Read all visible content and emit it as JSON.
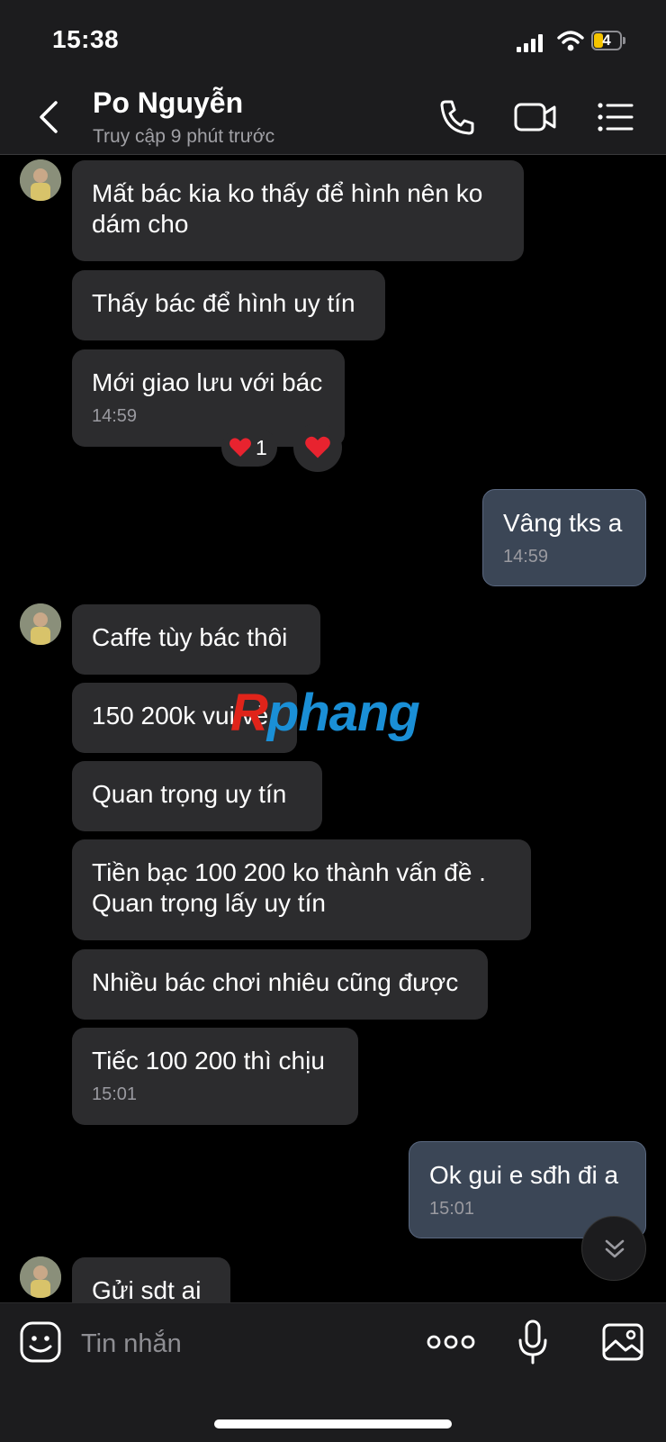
{
  "status_bar": {
    "time": "15:38",
    "battery": "4"
  },
  "header": {
    "contact_name": "Po Nguyễn",
    "contact_status": "Truy cập 9 phút trước",
    "icons": [
      "back-icon",
      "phone-icon",
      "video-camera-icon",
      "menu-list-icon"
    ]
  },
  "messages": [
    {
      "sender": "other",
      "text": "Mất bác kia ko thấy để hình nên ko dám cho"
    },
    {
      "sender": "other",
      "text": "Thấy bác để hình uy tín"
    },
    {
      "sender": "other",
      "text": "Mới giao lưu với bác",
      "time": "14:59",
      "reaction_count": "1"
    },
    {
      "sender": "me",
      "text": "Vâng tks a",
      "time": "14:59"
    },
    {
      "sender": "other",
      "text": "Caffe tùy bác thôi"
    },
    {
      "sender": "other",
      "text": "150 200k vui vẻ"
    },
    {
      "sender": "other",
      "text": "Quan trọng uy tín"
    },
    {
      "sender": "other",
      "text": "Tiền bạc 100 200 ko thành vấn đề . Quan trọng lấy uy tín"
    },
    {
      "sender": "other",
      "text": "Nhiều bác chơi nhiêu cũng được"
    },
    {
      "sender": "other",
      "text": "Tiếc 100 200 thì chịu",
      "time": "15:01"
    },
    {
      "sender": "me",
      "text": "Ok gui e sđh đi a",
      "time": "15:01"
    },
    {
      "sender": "other",
      "text": "Gửi sdt ai"
    }
  ],
  "watermark": {
    "part1": "R",
    "part2": "phang"
  },
  "input_bar": {
    "placeholder": "Tin nhắn",
    "icons": [
      "sticker-icon",
      "more-dots-icon",
      "microphone-icon",
      "image-icon"
    ]
  },
  "colors": {
    "bubble_other": "#2c2c2e",
    "bubble_me": "#3b4656",
    "background": "#000000",
    "header": "#1c1c1e"
  }
}
